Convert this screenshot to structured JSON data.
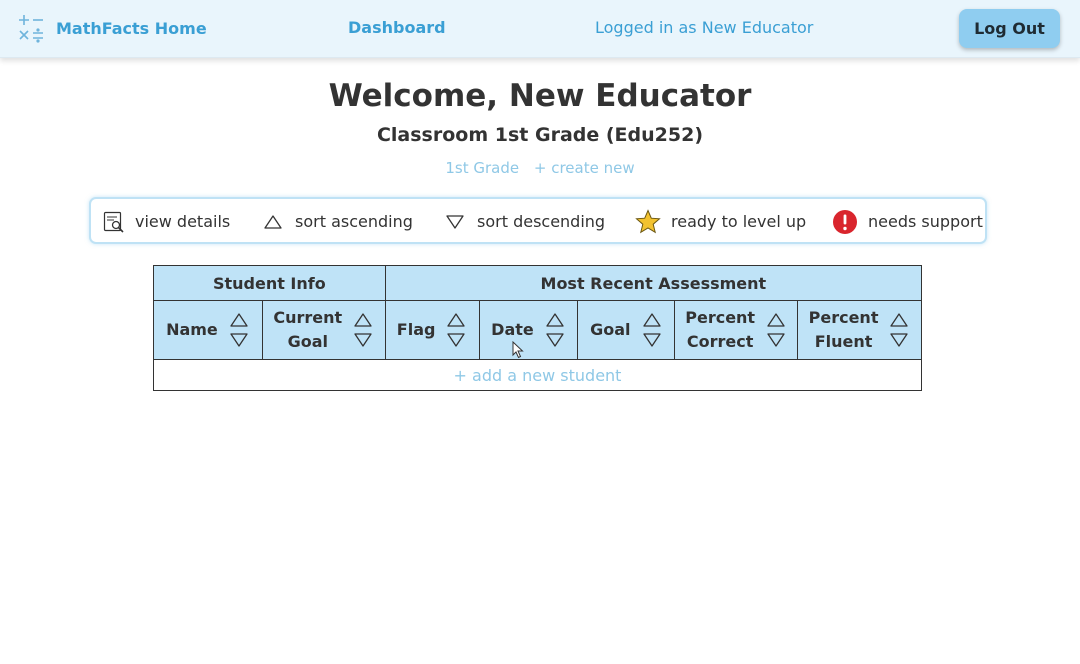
{
  "navbar": {
    "brand_label": "MathFacts Home",
    "brand_icon": "math-operators-icon",
    "dashboard_label": "Dashboard",
    "user_label": "Logged in as New Educator",
    "logout_label": "Log Out"
  },
  "header": {
    "welcome": "Welcome, New Educator",
    "classroom": "Classroom 1st Grade (Edu252)",
    "class_link": "1st Grade",
    "create_new": "+ create new"
  },
  "legend": {
    "view_details": "view details",
    "sort_ascending": "sort ascending",
    "sort_descending": "sort descending",
    "ready_to_level_up": "ready to level up",
    "needs_support": "needs support"
  },
  "table": {
    "group_student_info": "Student Info",
    "group_assessment": "Most Recent Assessment",
    "col_name": "Name",
    "col_goal_1": "Current",
    "col_goal_2": "Goal",
    "col_flag": "Flag",
    "col_date": "Date",
    "col_goal": "Goal",
    "col_correct_1": "Percent",
    "col_correct_2": "Correct",
    "col_fluent_1": "Percent",
    "col_fluent_2": "Fluent",
    "add_student": "+ add a new student"
  },
  "colors": {
    "accent": "#3a9fd4",
    "nav_bg": "#e9f5fc",
    "table_header": "#bfe3f7",
    "button": "#8fcdf0",
    "star": "#f2c230",
    "alert": "#d9252d"
  }
}
